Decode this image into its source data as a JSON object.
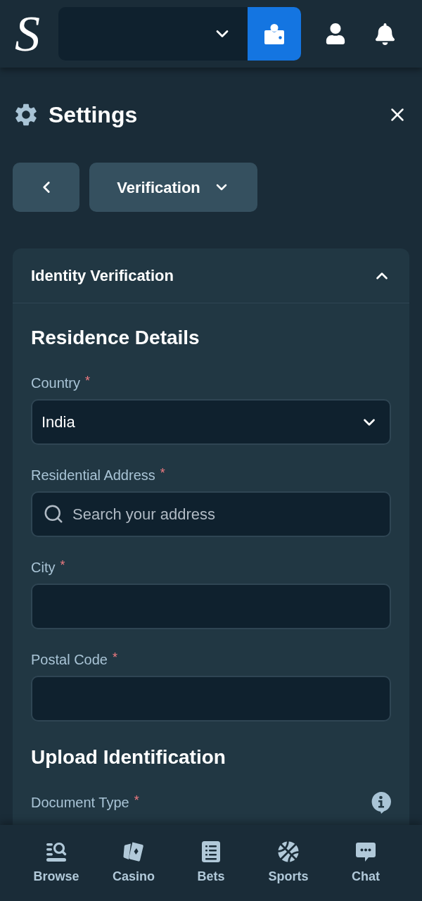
{
  "header": {
    "logo": "S"
  },
  "title": "Settings",
  "breadcrumb": {
    "section": "Verification"
  },
  "panel": {
    "title": "Identity Verification",
    "expanded": true,
    "sections": [
      {
        "heading": "Residence Details",
        "fields": [
          {
            "kind": "select",
            "label": "Country",
            "required_mark": "*",
            "value": "India"
          },
          {
            "kind": "search",
            "label": "Residential Address",
            "required_mark": "*",
            "placeholder": "Search your address"
          },
          {
            "kind": "text",
            "label": "City",
            "required_mark": "*"
          },
          {
            "kind": "text",
            "label": "Postal Code",
            "required_mark": "*"
          }
        ]
      },
      {
        "heading": "Upload Identification",
        "fields": [
          {
            "kind": "info",
            "label": "Document Type",
            "required_mark": "*"
          }
        ]
      }
    ]
  },
  "bottom_nav": [
    {
      "label": "Browse"
    },
    {
      "label": "Casino"
    },
    {
      "label": "Bets"
    },
    {
      "label": "Sports"
    },
    {
      "label": "Chat"
    }
  ]
}
